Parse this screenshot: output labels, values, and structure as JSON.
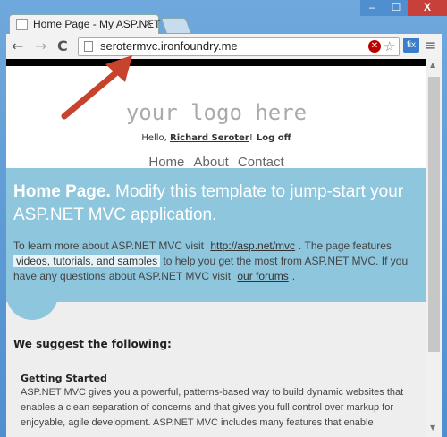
{
  "browser": {
    "tab_title": "Home Page - My ASP.NET",
    "tab_close": "×",
    "url": "serotermvc.ironfoundry.me",
    "fix_label": "fix",
    "window_controls": {
      "minimize": "–",
      "maximize": "☐",
      "close": "X"
    }
  },
  "nav_icons": {
    "back": "←",
    "forward": "→",
    "reload": "C",
    "menu": "≡",
    "star": "☆",
    "stop": "✕"
  },
  "site": {
    "logo": "your logo here",
    "login": {
      "hello": "Hello, ",
      "user": "Richard Seroter",
      "bang": "!",
      "logoff": "Log off"
    },
    "menu": [
      "Home",
      "About",
      "Contact"
    ]
  },
  "featured": {
    "title_bold": "Home Page.",
    "title_rest": " Modify this template to jump-start your ASP.NET MVC application.",
    "p1": "To learn more about ASP.NET MVC visit",
    "link1": "http://asp.net/mvc",
    "p2": ". The page features",
    "highlight": "videos, tutorials, and samples",
    "p3": "to help you get the most from ASP.NET MVC. If you have any questions about ASP.NET MVC visit",
    "link2": "our forums",
    "p4": "."
  },
  "content": {
    "suggest_heading": "We suggest the following:",
    "gs_heading": "Getting Started",
    "gs_body": "ASP.NET MVC gives you a powerful, patterns-based way to build dynamic websites that enables a clean separation of concerns and that gives you full control over markup for enjoyable, agile development. ASP.NET MVC includes many features that enable"
  },
  "colors": {
    "featured_bg": "#8ec6dd",
    "arrow": "#c8432d",
    "close_btn": "#c7413a"
  }
}
